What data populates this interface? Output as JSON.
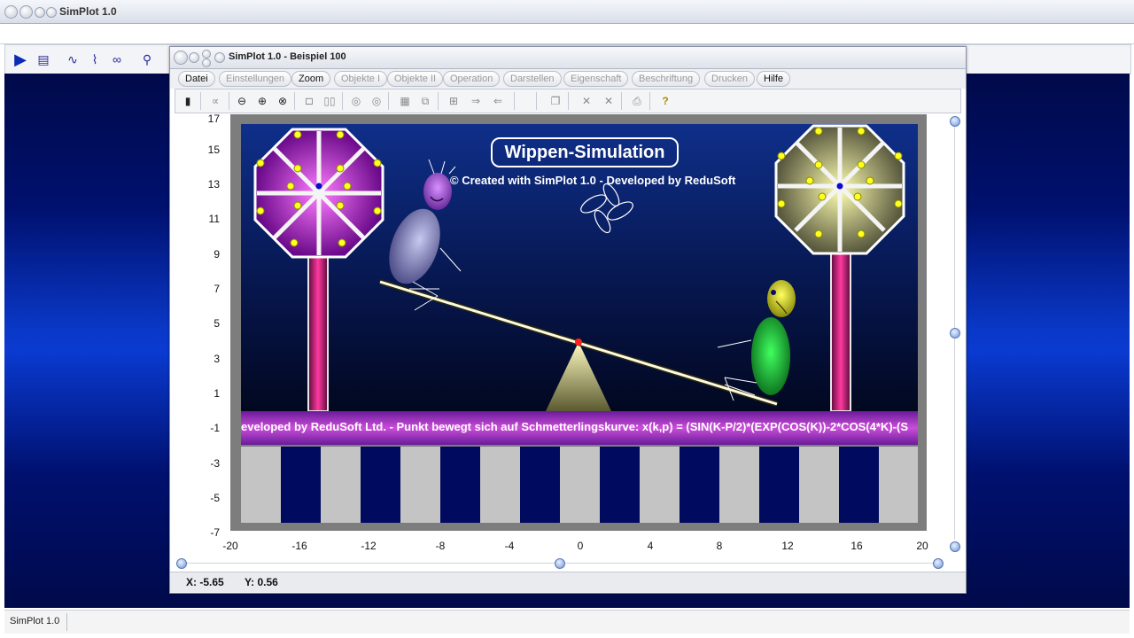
{
  "app": {
    "title": "SimPlot 1.0",
    "status": "SimPlot 1.0"
  },
  "window": {
    "title": "SimPlot 1.0 - Beispiel 100"
  },
  "menu": {
    "items": [
      {
        "label": "Datei",
        "active": true
      },
      {
        "label": "Einstellungen",
        "active": false
      },
      {
        "label": "Zoom",
        "active": true
      },
      {
        "label": "Objekte I",
        "active": false
      },
      {
        "label": "Objekte II",
        "active": false
      },
      {
        "label": "Operation",
        "active": false
      },
      {
        "label": "Darstellen",
        "active": false
      },
      {
        "label": "Eigenschaft",
        "active": false
      },
      {
        "label": "Beschriftung",
        "active": false
      },
      {
        "label": "Drucken",
        "active": false
      },
      {
        "label": "Hilfe",
        "active": true
      }
    ]
  },
  "plot": {
    "y_ticks": [
      "17",
      "15",
      "13",
      "11",
      "9",
      "7",
      "5",
      "3",
      "1",
      "-1",
      "-3",
      "-5",
      "-7"
    ],
    "x_ticks": [
      "-20",
      "-16",
      "-12",
      "-8",
      "-4",
      "0",
      "4",
      "8",
      "12",
      "16",
      "20"
    ],
    "scene_title": "Wippen-Simulation",
    "credit": "© Created with SimPlot 1.0 - Developed by ReduSoft",
    "ticker": "eveloped by ReduSoft Ltd.  -  Punkt bewegt sich auf Schmetterlingskurve: x(k,p) = (SIN(K-P/2)*(EXP(COS(K))-2*COS(4*K)-(S"
  },
  "status": {
    "x_readout": "X: -5.65",
    "y_readout": "Y: 0.56"
  },
  "colors": {
    "desktop": "#0a38c8",
    "ticker": "#c94ed8",
    "stripe_dark": "#000a5e",
    "stripe_light": "#c4c4c4"
  }
}
